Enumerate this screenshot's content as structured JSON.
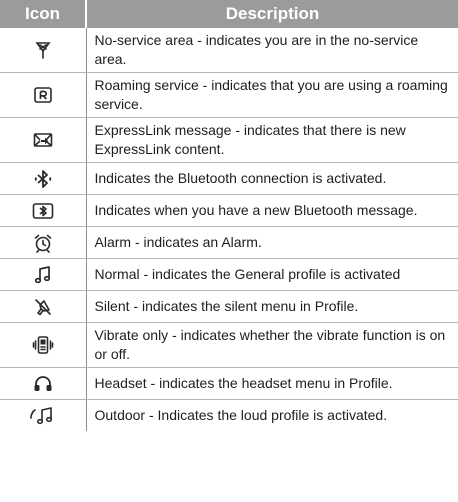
{
  "table": {
    "header_icon": "Icon",
    "header_description": "Description",
    "rows": [
      {
        "icon": "antenna-no-service-icon",
        "description": "No-service area - indicates you are in the no-service area."
      },
      {
        "icon": "roaming-r-icon",
        "description": "Roaming service - indicates that you are using a roaming service."
      },
      {
        "icon": "expresslink-envelope-icon",
        "description": "ExpressLink message - indicates that there is new ExpressLink content."
      },
      {
        "icon": "bluetooth-icon",
        "description": "Indicates the Bluetooth connection is activated."
      },
      {
        "icon": "bluetooth-message-icon",
        "description": "Indicates when you have a new Bluetooth message."
      },
      {
        "icon": "alarm-clock-icon",
        "description": "Alarm - indicates an Alarm."
      },
      {
        "icon": "music-note-icon",
        "description": "Normal - indicates the General profile is activated"
      },
      {
        "icon": "muted-speaker-icon",
        "description": "Silent - indicates the silent menu in Profile."
      },
      {
        "icon": "vibrate-phone-icon",
        "description": "Vibrate only - indicates whether the vibrate function is on or off."
      },
      {
        "icon": "headset-icon",
        "description": "Headset - indicates the headset menu in Profile."
      },
      {
        "icon": "loud-music-note-icon",
        "description": "Outdoor - Indicates the loud profile is activated."
      }
    ]
  },
  "colors": {
    "header_bg": "#9b9b9b",
    "header_text": "#ffffff",
    "row_divider": "#b5b5b5",
    "icon_stroke": "#2a2a2a"
  }
}
